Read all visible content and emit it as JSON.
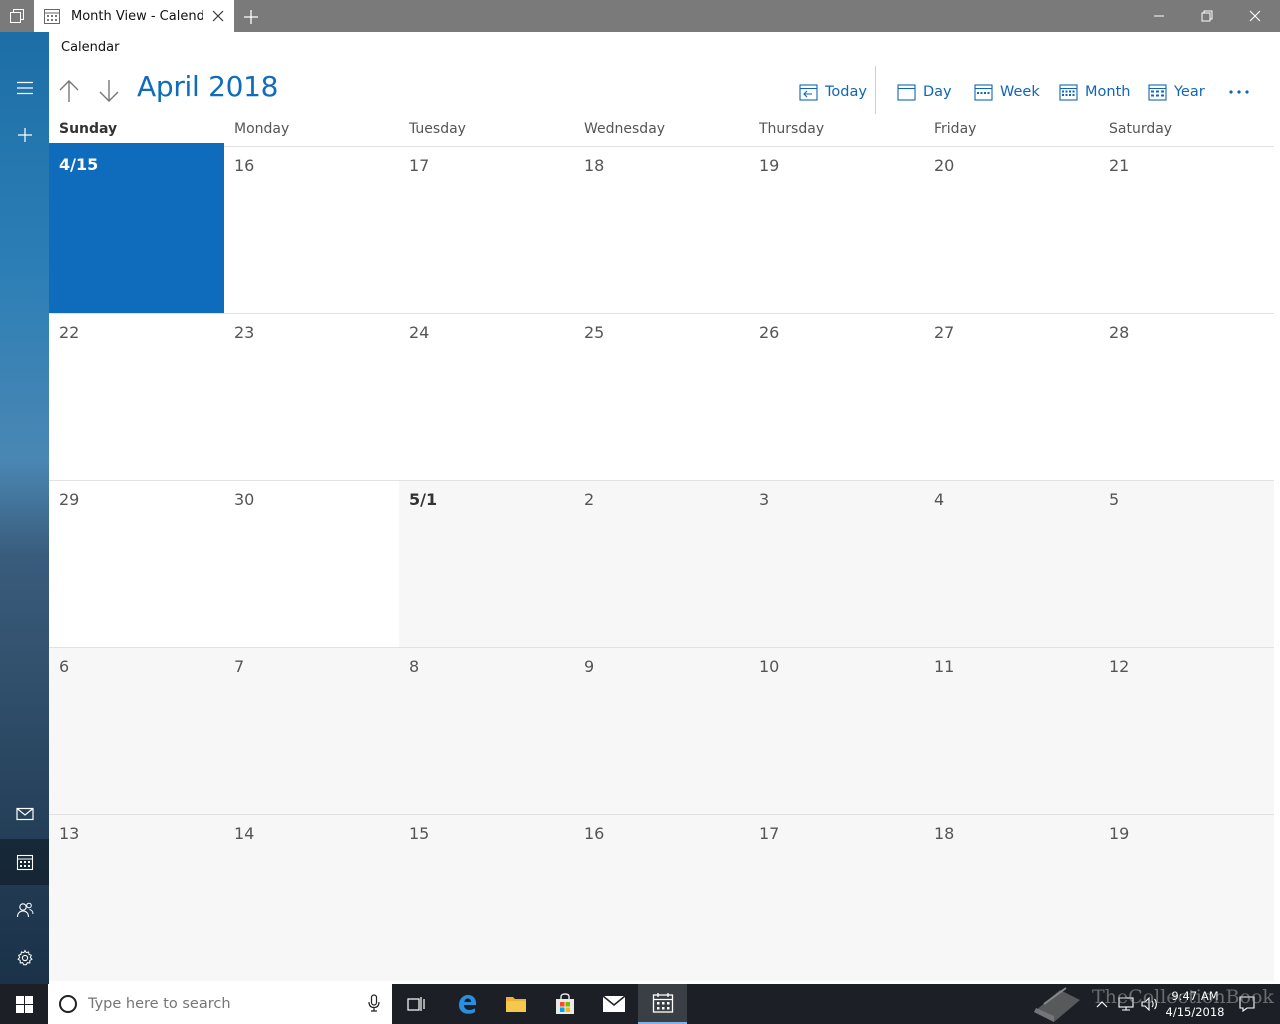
{
  "window": {
    "tab_title": "Month View - Calendar",
    "app_name": "Calendar"
  },
  "header": {
    "month_title": "April 2018",
    "toolbar": {
      "today": "Today",
      "day": "Day",
      "week": "Week",
      "month": "Month",
      "year": "Year"
    }
  },
  "weekdays": [
    "Sunday",
    "Monday",
    "Tuesday",
    "Wednesday",
    "Thursday",
    "Friday",
    "Saturday"
  ],
  "weeks": [
    [
      "4/15",
      "16",
      "17",
      "18",
      "19",
      "20",
      "21"
    ],
    [
      "22",
      "23",
      "24",
      "25",
      "26",
      "27",
      "28"
    ],
    [
      "29",
      "30",
      "5/1",
      "2",
      "3",
      "4",
      "5"
    ],
    [
      "6",
      "7",
      "8",
      "9",
      "10",
      "11",
      "12"
    ],
    [
      "13",
      "14",
      "15",
      "16",
      "17",
      "18",
      "19"
    ]
  ],
  "taskbar": {
    "search_placeholder": "Type here to search",
    "time": "9:47 AM",
    "date": "4/15/2018"
  },
  "watermark": "TheCollectionBook",
  "colors": {
    "accent": "#0f6cbd",
    "taskbar": "#1c2026",
    "titlebar": "#7a7a7a"
  }
}
